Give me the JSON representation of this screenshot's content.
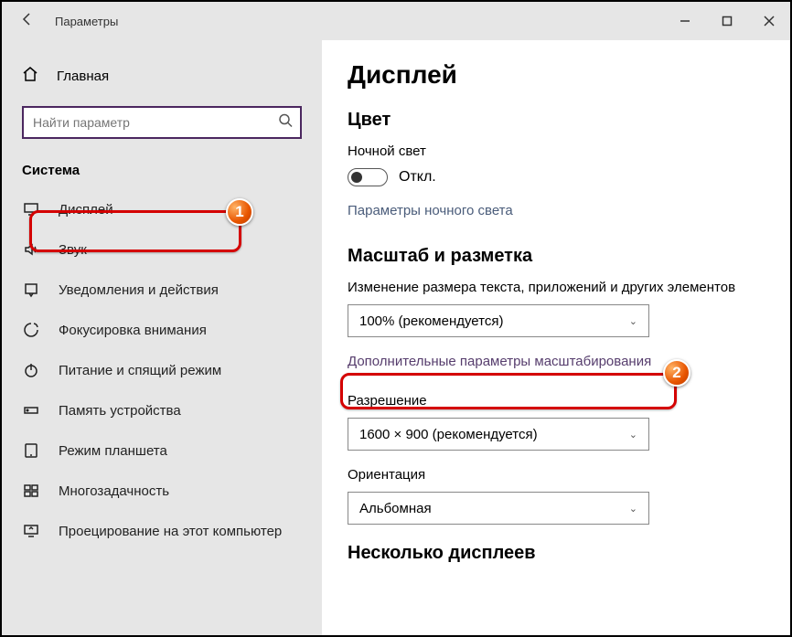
{
  "titlebar": {
    "title": "Параметры"
  },
  "sidebar": {
    "home": "Главная",
    "searchPlaceholder": "Найти параметр",
    "section": "Система",
    "items": [
      {
        "icon": "display",
        "label": "Дисплей"
      },
      {
        "icon": "sound",
        "label": "Звук"
      },
      {
        "icon": "notify",
        "label": "Уведомления и действия"
      },
      {
        "icon": "focus",
        "label": "Фокусировка внимания"
      },
      {
        "icon": "power",
        "label": "Питание и спящий режим"
      },
      {
        "icon": "storage",
        "label": "Память устройства"
      },
      {
        "icon": "tablet",
        "label": "Режим планшета"
      },
      {
        "icon": "multi",
        "label": "Многозадачность"
      },
      {
        "icon": "project",
        "label": "Проецирование на этот компьютер"
      }
    ]
  },
  "content": {
    "pageTitle": "Дисплей",
    "colorSection": "Цвет",
    "nightLightLabel": "Ночной свет",
    "nightLightState": "Откл.",
    "nightLightLink": "Параметры ночного света",
    "scaleSection": "Масштаб и разметка",
    "scaleLabel": "Изменение размера текста, приложений и других элементов",
    "scaleValue": "100% (рекомендуется)",
    "scaleLink": "Дополнительные параметры масштабирования",
    "resolutionLabel": "Разрешение",
    "resolutionValue": "1600 × 900 (рекомендуется)",
    "orientationLabel": "Ориентация",
    "orientationValue": "Альбомная",
    "multiDisplaySection": "Несколько дисплеев"
  },
  "annotations": {
    "badge1": "1",
    "badge2": "2"
  }
}
